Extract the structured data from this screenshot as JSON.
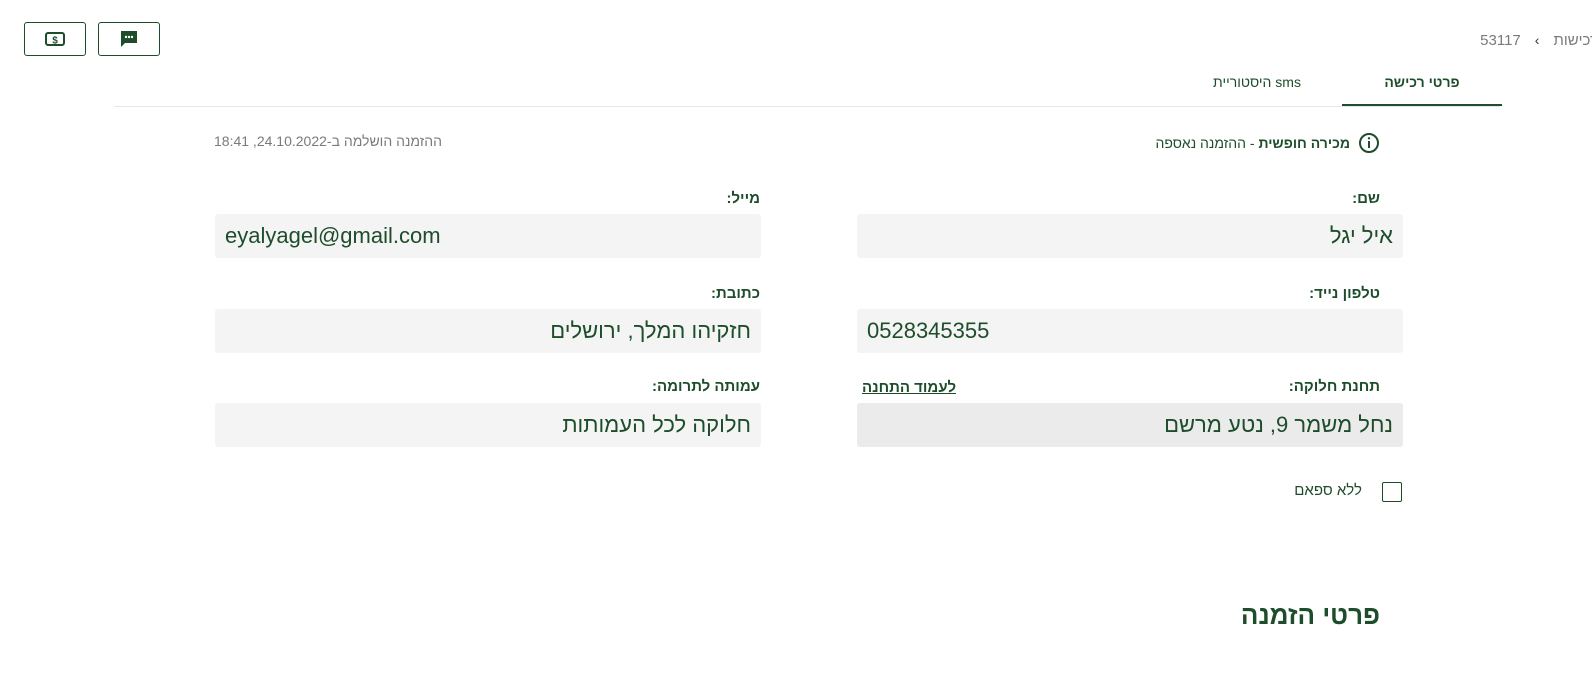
{
  "header": {
    "breadcrumb_parent": "רכישות",
    "breadcrumb_id": "53117",
    "buttons": [
      {
        "name": "payment-button",
        "icon": "dollar-bill-icon"
      },
      {
        "name": "sms-button",
        "icon": "chat-bubble-icon"
      }
    ]
  },
  "tabs": [
    {
      "label": "פרטי רכישה",
      "active": true
    },
    {
      "label": "היסטוריית sms",
      "active": false
    }
  ],
  "status": {
    "type_bold": "מכירה חופשית",
    "separator": " - ",
    "state": "ההזמנה נאספה",
    "completed": "ההזמנה הושלמה ב-24.10.2022, 18:41"
  },
  "form": {
    "name_label": "שם:",
    "name_value": "איל יגל",
    "email_label": "מייל:",
    "email_value": "eyalyagel@gmail.com",
    "phone_label": "טלפון נייד:",
    "phone_value": "0528345355",
    "address_label": "כתובת:",
    "address_value": "חזקיהו המלך, ירושלים",
    "station_label": "תחנת חלוקה:",
    "station_link": "לעמוד התחנה",
    "station_value": "נחל משמר 9, נטע מרשם",
    "charity_label": "עמותה לתרומה:",
    "charity_value": "חלוקה לכל העמותות",
    "no_spam_label": "ללא ספאם",
    "no_spam_checked": false
  },
  "section": {
    "order_details_title": "פרטי הזמנה"
  },
  "colors": {
    "primary": "#1e4d2b",
    "field_bg": "#f4f4f4",
    "muted_text": "#7a7a7a"
  }
}
